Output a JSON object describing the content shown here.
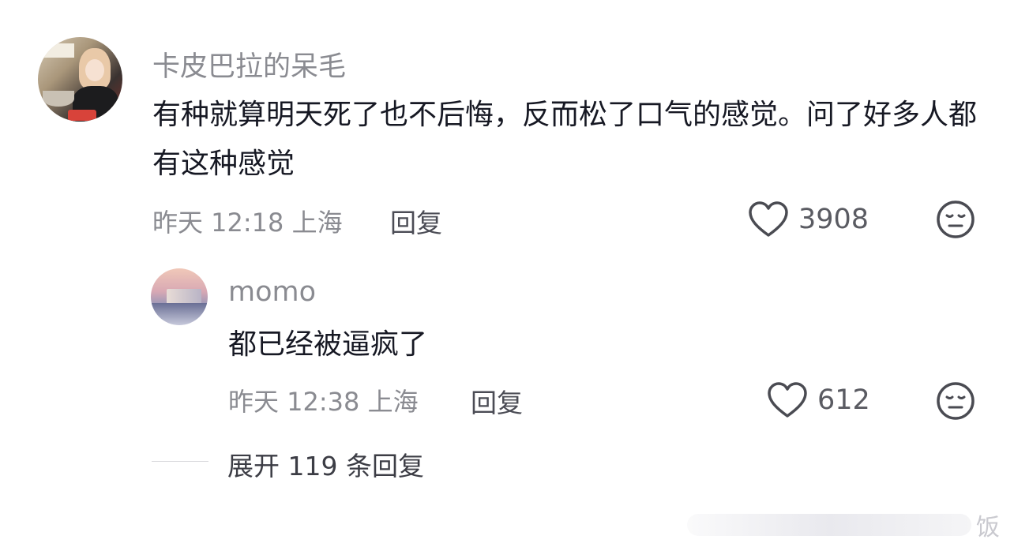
{
  "comment": {
    "username": "卡皮巴拉的呆毛",
    "text": "有种就算明天死了也不后悔，反而松了口气的感觉。问了好多人都有这种感觉",
    "time": "昨天 12:18",
    "location": "上海",
    "reply_label": "回复",
    "likes": "3908"
  },
  "reply": {
    "username": "momo",
    "text": "都已经被逼疯了",
    "time": "昨天 12:38",
    "location": "上海",
    "reply_label": "回复",
    "likes": "612"
  },
  "expand_label": "展开 119 条回复",
  "watermark": "饭",
  "icons": {
    "like": "heart-outline-icon",
    "dislike": "neutral-face-icon"
  }
}
